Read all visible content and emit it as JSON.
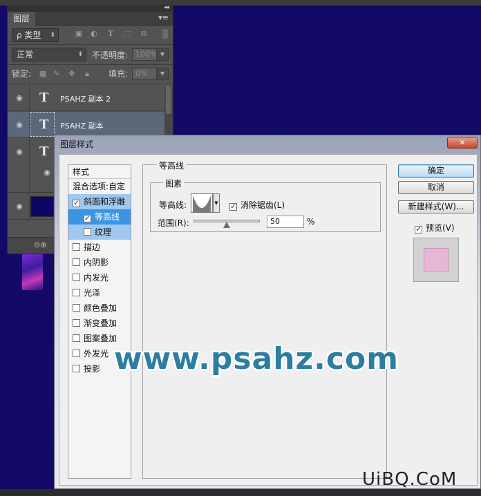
{
  "layers_panel": {
    "tab_label": "图层",
    "collapse_glyph": "◂◂",
    "menu_glyph": "▾≡",
    "filter_kind": "ρ 类型",
    "blend_mode": "正常",
    "opacity_label": "不透明度:",
    "opacity_value": "100%",
    "lock_label": "锁定:",
    "fill_label": "填充:",
    "fill_value": "0%",
    "layers": [
      {
        "name": "PSAHZ 副本 2",
        "type": "text"
      },
      {
        "name": "PSAHZ 副本",
        "type": "text",
        "active": true
      },
      {
        "name": "",
        "type": "text"
      },
      {
        "name": "",
        "type": "fill",
        "swatch": "#0c0766"
      }
    ],
    "link_glyph": "⊖⊕"
  },
  "dialog": {
    "title": "图层样式",
    "close_glyph": "✕",
    "styles_header": "样式",
    "blend_options": "混合选项:自定",
    "style_items": [
      {
        "label": "斜面和浮雕",
        "checked": true,
        "state": "selected-light"
      },
      {
        "label": "等高线",
        "checked": true,
        "state": "selected",
        "sub": true
      },
      {
        "label": "纹理",
        "checked": false,
        "state": "selected-light",
        "sub": true
      },
      {
        "label": "描边",
        "checked": false
      },
      {
        "label": "内阴影",
        "checked": false
      },
      {
        "label": "内发光",
        "checked": false
      },
      {
        "label": "光泽",
        "checked": false
      },
      {
        "label": "颜色叠加",
        "checked": false
      },
      {
        "label": "渐变叠加",
        "checked": false
      },
      {
        "label": "图案叠加",
        "checked": false
      },
      {
        "label": "外发光",
        "checked": false
      },
      {
        "label": "投影",
        "checked": false
      }
    ],
    "section_title": "等高线",
    "group_title": "图素",
    "contour_label": "等高线:",
    "anti_alias_label": "消除锯齿(L)",
    "anti_alias_checked": true,
    "range_label": "范围(R):",
    "range_value": "50",
    "range_unit": "%",
    "range_fraction": 0.5,
    "buttons": {
      "ok": "确定",
      "cancel": "取消",
      "new_style": "新建样式(W)...",
      "preview": "预览(V)"
    },
    "preview_checked": true
  },
  "watermarks": {
    "main": "www.psahz.com",
    "corner": "UiBQ.CoM"
  },
  "colors": {
    "canvas": "#120a66",
    "panel": "#535353",
    "selected_item": "#3b95e5"
  }
}
